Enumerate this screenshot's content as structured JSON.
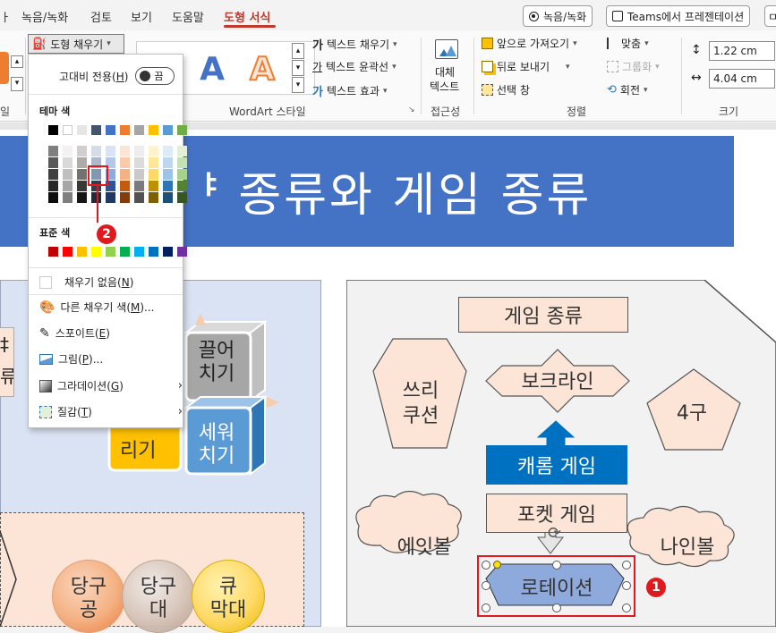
{
  "menu": {
    "tabs": [
      "녹음/녹화",
      "검토",
      "보기",
      "도움말",
      "도형 서식"
    ],
    "active_tab": "도형 서식",
    "record_button": "녹음/녹화",
    "teams_button": "Teams에서 프레젠테이션",
    "right_edge_button": "ㅁ"
  },
  "ribbon": {
    "fill_button": "도형 채우기",
    "text_fill": "텍스트 채우기",
    "text_outline": "텍스트 윤곽선",
    "text_effect": "텍스트 효과",
    "wordart_label": "WordArt 스타일",
    "wordart_glyph": "A",
    "alt_text_line1": "대체",
    "alt_text_line2": "텍스트",
    "accessibility_label": "접근성",
    "bring_forward": "앞으로 가져오기",
    "send_backward": "뒤로 보내기",
    "selection_pane": "선택 창",
    "align": "맞춤",
    "group": "그룹화",
    "rotate": "회전",
    "arrange_label": "정렬",
    "height_value": "1.22 cm",
    "width_value": "4.04 cm",
    "size_label": "크기",
    "left_group_label": "일"
  },
  "fill_menu": {
    "high_contrast_label": "고대비 전용",
    "high_contrast_key": "H",
    "toggle_text": "끔",
    "theme_colors_label": "테마 색",
    "standard_colors_label": "표준 색",
    "no_fill": "채우기 없음",
    "no_fill_key": "N",
    "more_colors": "다른 채우기 색",
    "more_colors_key": "M",
    "more_colors_suffix": "...",
    "eyedropper": "스포이트",
    "eyedropper_key": "E",
    "picture": "그림",
    "picture_key": "P",
    "picture_suffix": "...",
    "gradient": "그라데이션",
    "gradient_key": "G",
    "texture": "질감",
    "texture_key": "T",
    "theme_row": [
      "#000000",
      "#ffffff",
      "#e7e6e6",
      "#44546a",
      "#4472c4",
      "#ed7d31",
      "#a5a5a5",
      "#ffc000",
      "#5b9bd5",
      "#70ad47"
    ],
    "theme_shades": [
      [
        "#7f7f7f",
        "#595959",
        "#404040",
        "#262626",
        "#0d0d0d"
      ],
      [
        "#f2f2f2",
        "#d9d9d9",
        "#bfbfbf",
        "#a6a6a6",
        "#7f7f7f"
      ],
      [
        "#d0cece",
        "#aeaaaa",
        "#757171",
        "#3a3838",
        "#171616"
      ],
      [
        "#d6dce5",
        "#adb9ca",
        "#8497b0",
        "#333f50",
        "#222a35"
      ],
      [
        "#dae3f3",
        "#b4c7e7",
        "#8faadc",
        "#2f5597",
        "#1f3864"
      ],
      [
        "#fbe5d6",
        "#f8cbad",
        "#f4b183",
        "#c55a11",
        "#843c0c"
      ],
      [
        "#ededed",
        "#dbdbdb",
        "#c9c9c9",
        "#7b7b7b",
        "#525252"
      ],
      [
        "#fff2cc",
        "#ffe699",
        "#ffd966",
        "#bf9000",
        "#7f6000"
      ],
      [
        "#deebf7",
        "#bdd7ee",
        "#9dc3e6",
        "#2e75b6",
        "#1f4e79"
      ],
      [
        "#e2f0d9",
        "#c5e0b4",
        "#a9d18e",
        "#548235",
        "#375623"
      ]
    ],
    "standard_row": [
      "#c00000",
      "#ff0000",
      "#ffc000",
      "#ffff00",
      "#92d050",
      "#00b050",
      "#00b0f0",
      "#0070c0",
      "#002060",
      "#7030a0"
    ]
  },
  "slide": {
    "title": "놀이 방식 종류와 게임 종류",
    "title_visible": "ᅣ 종류와 게임 종류",
    "left_cards": {
      "pull": "끌어\n치기",
      "push": "세워\n치기",
      "partial_text": "리기",
      "partial_top": "",
      "side_text": "‡\n류"
    },
    "balls": [
      "당구\n공",
      "당구\n대",
      "큐\n막대"
    ],
    "right": {
      "game_types": "게임 종류",
      "sseuri_cushion": "쓰리\n쿠션",
      "bokeurain": "보크라인",
      "four_ball": "4구",
      "carom": "캐롬 게임",
      "pocket": "포켓 게임",
      "eight_ball": "에잇볼",
      "nine_ball": "나인볼",
      "rotation": "로테이션"
    },
    "badge_1": "1",
    "badge_2": "2"
  },
  "colors": {
    "accent": "#c0392b",
    "title_blue": "#4472c4",
    "shape_peach": "#fce4d6",
    "carom_blue": "#0070c0",
    "rotation_blue": "#8eaadc",
    "highlight_red": "#e0191f"
  }
}
